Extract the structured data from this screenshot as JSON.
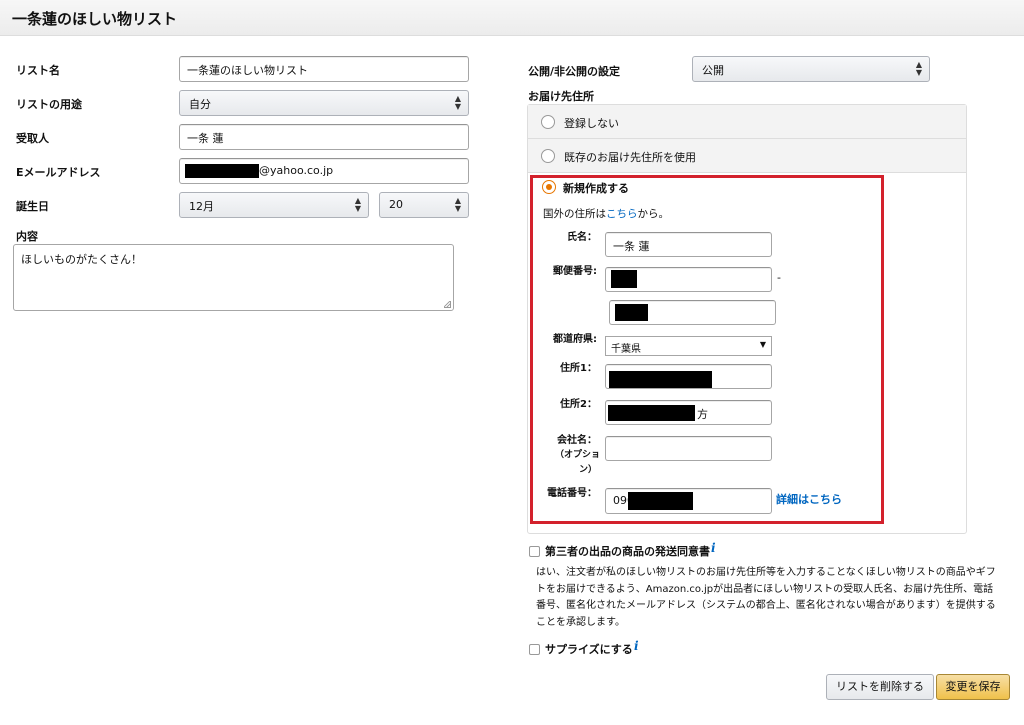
{
  "page_title": "一条蓮のほしい物リスト",
  "left": {
    "list_name_label": "リスト名",
    "list_name_value": "一条蓮のほしい物リスト",
    "purpose_label": "リストの用途",
    "purpose_value": "自分",
    "recipient_label": "受取人",
    "recipient_value": "一条 蓮",
    "email_label": "Eメールアドレス",
    "email_domain": "@yahoo.co.jp",
    "birthday_label": "誕生日",
    "birthday_month": "12月",
    "birthday_day": "20",
    "content_label": "内容",
    "content_value": "ほしいものがたくさん！"
  },
  "right": {
    "visibility_label": "公開/非公開の設定",
    "visibility_value": "公開",
    "address_label": "お届け先住所",
    "options": [
      {
        "label": "登録しない",
        "selected": false
      },
      {
        "label": "既存のお届け先住所を使用",
        "selected": false
      },
      {
        "label": "新規作成する",
        "selected": true
      }
    ],
    "overseas_prefix": "国外の住所は",
    "overseas_link": "こちら",
    "overseas_suffix": "から。",
    "name_label": "氏名：",
    "name_value": "一条 蓮",
    "postal_label": "郵便番号:",
    "postal_dash": "-",
    "prefecture_label": "都道府県:",
    "prefecture_value": "千葉県",
    "address1_label": "住所1：",
    "address2_label": "住所2：",
    "address2_suffix": "方",
    "company_label_1": "会社名：",
    "company_label_2": "（オプショ",
    "company_label_3": "ン）",
    "phone_label": "電話番号：",
    "phone_prefix": "090",
    "phone_details_link": "詳細はこちら",
    "third_party_label": "第三者の出品の商品の発送同意書",
    "third_party_text": "はい、注文者が私のほしい物リストのお届け先住所等を入力することなくほしい物リストの商品やギフトをお届けできるよう、Amazon.co.jpが出品者にほしい物リストの受取人氏名、お届け先住所、電話番号、匿名化されたメールアドレス（システムの都合上、匿名化されない場合があります）を提供することを承認します。",
    "surprise_label": "サプライズにする",
    "info_glyph": "i"
  },
  "buttons": {
    "delete": "リストを削除する",
    "save": "変更を保存"
  },
  "colors": {
    "accent_link": "#0066c0",
    "highlight_border": "#d3212c",
    "radio_selected": "#e77600",
    "save_button": "#f0c14b"
  }
}
